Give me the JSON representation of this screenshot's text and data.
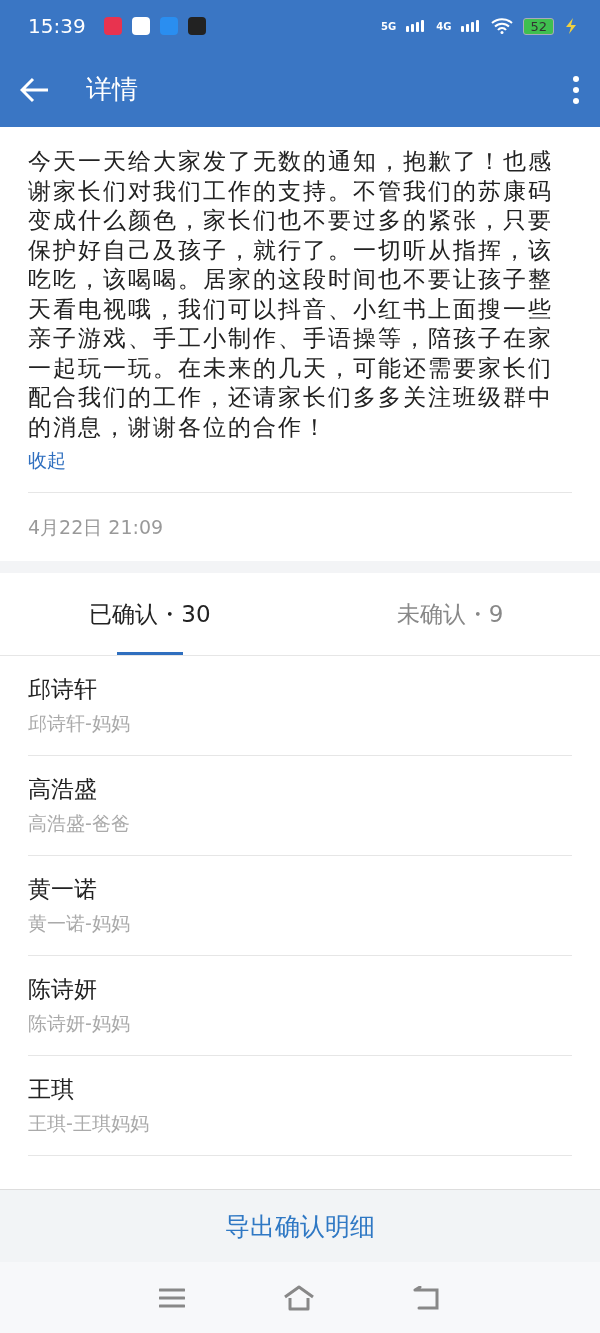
{
  "status_bar": {
    "time": "15:39",
    "network_1": "5G",
    "network_2": "4G",
    "battery": "52"
  },
  "app_bar": {
    "title": "详情"
  },
  "notice": {
    "body": "今天一天给大家发了无数的通知，抱歉了！也感谢家长们对我们工作的支持。不管我们的苏康码变成什么颜色，家长们也不要过多的紧张，只要保护好自己及孩子，就行了。一切听从指挥，该吃吃，该喝喝。居家的这段时间也不要让孩子整天看电视哦，我们可以抖音、小红书上面搜一些亲子游戏、手工小制作、手语操等，陪孩子在家一起玩一玩。在未来的几天，可能还需要家长们配合我们的工作，还请家长们多多关注班级群中的消息，谢谢各位的合作！",
    "collapse_link": "收起",
    "time": "4月22日 21:09"
  },
  "tabs": [
    {
      "label": "已确认・30",
      "selected": true
    },
    {
      "label": "未确认・9",
      "selected": false
    }
  ],
  "people": [
    {
      "name": "邱诗轩",
      "relation": "邱诗轩-妈妈"
    },
    {
      "name": "高浩盛",
      "relation": "高浩盛-爸爸"
    },
    {
      "name": "黄一诺",
      "relation": "黄一诺-妈妈"
    },
    {
      "name": "陈诗妍",
      "relation": "陈诗妍-妈妈"
    },
    {
      "name": "王琪",
      "relation": "王琪-王琪妈妈"
    }
  ],
  "export_button": "导出确认明细"
}
